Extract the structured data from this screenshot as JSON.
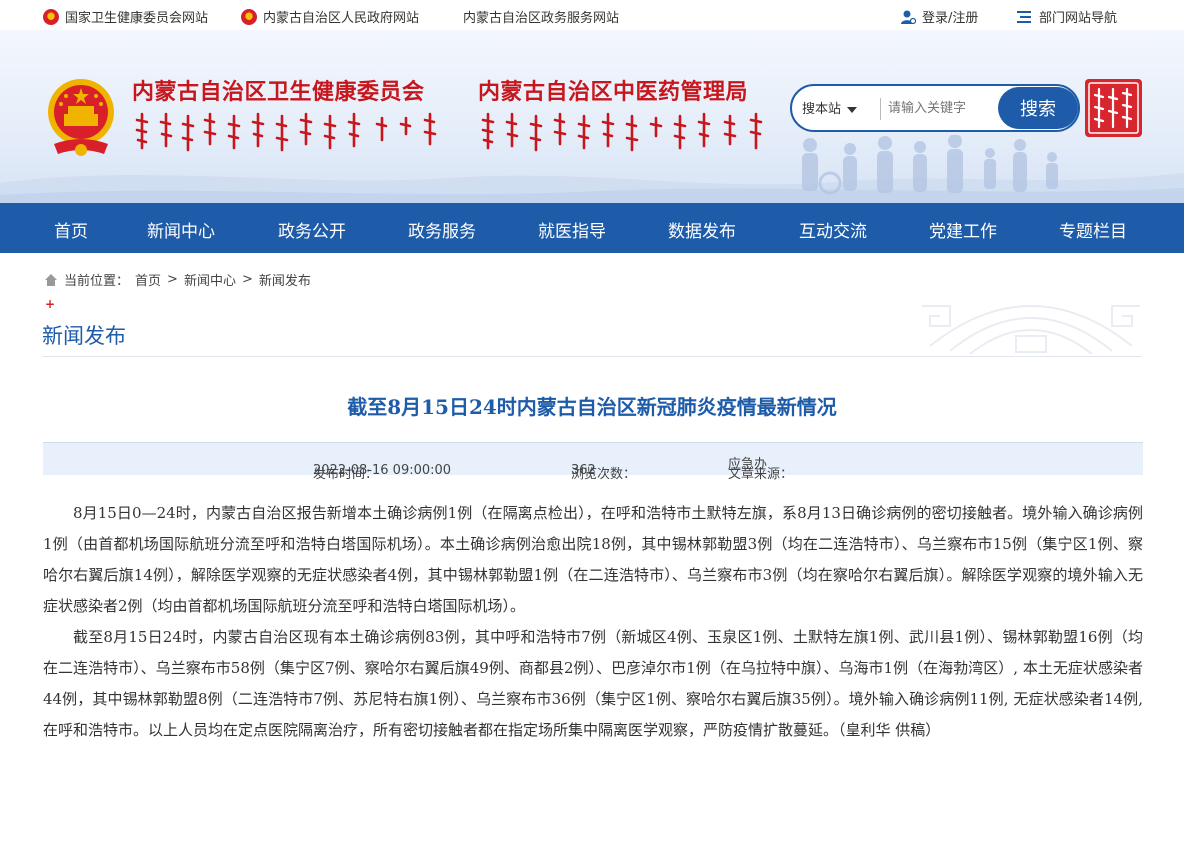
{
  "topbar": {
    "links": [
      "国家卫生健康委员会网站",
      "内蒙古自治区人民政府网站",
      "内蒙古自治区政务服务网站"
    ],
    "login": "登录/注册",
    "dept_nav": "部门网站导航"
  },
  "header": {
    "title_left": "内蒙古自治区卫生健康委员会",
    "title_right": "内蒙古自治区中医药管理局"
  },
  "search": {
    "site_label": "搜本站",
    "placeholder": "请输入关键字",
    "button": "搜索"
  },
  "nav": {
    "items": [
      "首页",
      "新闻中心",
      "政务公开",
      "政务服务",
      "就医指导",
      "数据发布",
      "互动交流",
      "党建工作",
      "专题栏目"
    ]
  },
  "breadcrumb": {
    "prefix": "当前位置：",
    "items": [
      "首页",
      "新闻中心",
      "新闻发布"
    ],
    "sep": ">"
  },
  "section": {
    "plus": "+",
    "title": "新闻发布"
  },
  "article": {
    "title": "截至8月15日24时内蒙古自治区新冠肺炎疫情最新情况",
    "publish_label": "发布时间：",
    "publish_time": "2022-08-16 09:00:00",
    "views_label": "浏览次数：",
    "views": "362",
    "source_label": "文章来源：",
    "source": "应急办",
    "paragraphs": [
      "8月15日0—24时，内蒙古自治区报告新增本土确诊病例1例（在隔离点检出），在呼和浩特市土默特左旗，系8月13日确诊病例的密切接触者。境外输入确诊病例1例（由首都机场国际航班分流至呼和浩特白塔国际机场）。本土确诊病例治愈出院18例，其中锡林郭勒盟3例（均在二连浩特市）、乌兰察布市15例（集宁区1例、察哈尔右翼后旗14例），解除医学观察的无症状感染者4例，其中锡林郭勒盟1例（在二连浩特市）、乌兰察布市3例（均在察哈尔右翼后旗）。解除医学观察的境外输入无症状感染者2例（均由首都机场国际航班分流至呼和浩特白塔国际机场）。",
      "截至8月15日24时，内蒙古自治区现有本土确诊病例83例，其中呼和浩特市7例（新城区4例、玉泉区1例、土默特左旗1例、武川县1例）、锡林郭勒盟16例（均在二连浩特市）、乌兰察布市58例（集宁区7例、察哈尔右翼后旗49例、商都县2例）、巴彦淖尔市1例（在乌拉特中旗）、乌海市1例（在海勃湾区）, 本土无症状感染者44例，其中锡林郭勒盟8例（二连浩特市7例、苏尼特右旗1例）、乌兰察布市36例（集宁区1例、察哈尔右翼后旗35例）。境外输入确诊病例11例, 无症状感染者14例, 在呼和浩特市。以上人员均在定点医院隔离治疗，所有密切接触者都在指定场所集中隔离医学观察，严防疫情扩散蔓延。（皇利华 供稿）"
    ]
  },
  "colors": {
    "primary": "#1e5ba8",
    "red": "#c8161d",
    "meta_bg": "#e8f1fb"
  }
}
